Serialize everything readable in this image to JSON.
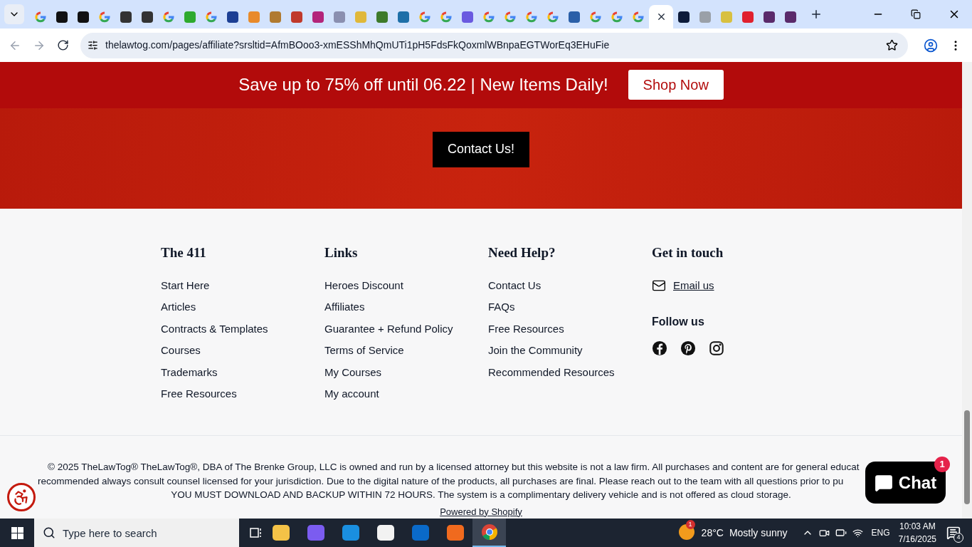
{
  "browser": {
    "tabs": [
      {
        "kind": "google",
        "selected": false
      },
      {
        "kind": "mark",
        "color": "#111111",
        "selected": false
      },
      {
        "kind": "mark",
        "color": "#111111",
        "selected": false
      },
      {
        "kind": "google",
        "selected": false
      },
      {
        "kind": "mark",
        "color": "#333333",
        "selected": false
      },
      {
        "kind": "mark",
        "color": "#333333",
        "selected": false
      },
      {
        "kind": "google",
        "selected": false
      },
      {
        "kind": "mark",
        "color": "#2eaa2e",
        "selected": false
      },
      {
        "kind": "google",
        "selected": false
      },
      {
        "kind": "mark",
        "color": "#1c3f94",
        "selected": false
      },
      {
        "kind": "mark",
        "color": "#e88a2a",
        "selected": false
      },
      {
        "kind": "mark",
        "color": "#b07a30",
        "selected": false
      },
      {
        "kind": "mark",
        "color": "#c0392b",
        "selected": false
      },
      {
        "kind": "mark",
        "color": "#b3247a",
        "selected": false
      },
      {
        "kind": "mark",
        "color": "#8a8fb0",
        "selected": false
      },
      {
        "kind": "mark",
        "color": "#e0b83a",
        "selected": false
      },
      {
        "kind": "mark",
        "color": "#3d7a2a",
        "selected": false
      },
      {
        "kind": "mark",
        "color": "#1e6fa8",
        "selected": false
      },
      {
        "kind": "google",
        "selected": false
      },
      {
        "kind": "google",
        "selected": false
      },
      {
        "kind": "mark",
        "color": "#6a5ae0",
        "selected": false
      },
      {
        "kind": "google",
        "selected": false
      },
      {
        "kind": "google",
        "selected": false
      },
      {
        "kind": "google",
        "selected": false
      },
      {
        "kind": "google",
        "selected": false
      },
      {
        "kind": "mark",
        "color": "#2a5fa8",
        "selected": false
      },
      {
        "kind": "google",
        "selected": false
      },
      {
        "kind": "google",
        "selected": false
      },
      {
        "kind": "google",
        "selected": false
      },
      {
        "kind": "blank",
        "selected": true
      },
      {
        "kind": "mark",
        "color": "#0d1b3a",
        "selected": false
      },
      {
        "kind": "mark",
        "color": "#9aa0a8",
        "selected": false
      },
      {
        "kind": "mark",
        "color": "#d8c040",
        "selected": false
      },
      {
        "kind": "mark",
        "color": "#e0202e",
        "selected": false
      },
      {
        "kind": "mark",
        "color": "#5a2a6a",
        "selected": false
      },
      {
        "kind": "mark",
        "color": "#5a2a6a",
        "selected": false
      }
    ],
    "url": "thelawtog.com/pages/affiliate?srsltid=AfmBOoo3-xmESShMhQmUTi1pH5FdsFkQoxmlWBnpaEGTWorEq3EHuFie"
  },
  "promo_bar": {
    "text": "Save up to 75% off until 06.22 | New Items Daily!",
    "button": "Shop Now"
  },
  "contact_button": "Contact Us!",
  "footer": {
    "columns": [
      {
        "heading": "The 411",
        "links": [
          "Start Here",
          "Articles",
          "Contracts & Templates",
          "Courses",
          "Trademarks",
          "Free Resources"
        ]
      },
      {
        "heading": "Links",
        "links": [
          "Heroes Discount",
          "Affiliates",
          "Guarantee + Refund Policy",
          "Terms of Service",
          "My Courses",
          "My account"
        ]
      },
      {
        "heading": "Need Help?",
        "links": [
          "Contact Us",
          "FAQs",
          "Free Resources",
          "Join the Community",
          "Recommended Resources"
        ]
      }
    ],
    "get_in_touch": {
      "heading": "Get in touch",
      "email": "Email us",
      "follow_heading": "Follow us"
    },
    "legal_lines": [
      "© 2025 TheLawTog® TheLawTog®, DBA of The Brenke Group, LLC is owned and run by a licensed attorney but this website is not a law firm. All purchases and content are for general educat",
      "recommended always consult counsel licensed for your jurisdiction. Due to the digital nature of the products, all purchases are final. Please reach out to the team with all questions prior to pu",
      "YOU MUST DOWNLOAD AND BACKUP WITHIN 72 HOURS. The system is a complimentary delivery vehicle and is not offered as cloud storage."
    ],
    "powered_by": "Powered by Shopify"
  },
  "chat": {
    "label": "Chat",
    "badge": "1"
  },
  "taskbar": {
    "search_placeholder": "Type here to search",
    "weather_badge": "1",
    "temperature": "28°C",
    "weather": "Mostly sunny",
    "language": "ENG",
    "time": "10:03 AM",
    "date": "7/16/2025",
    "notifications": "4"
  }
}
